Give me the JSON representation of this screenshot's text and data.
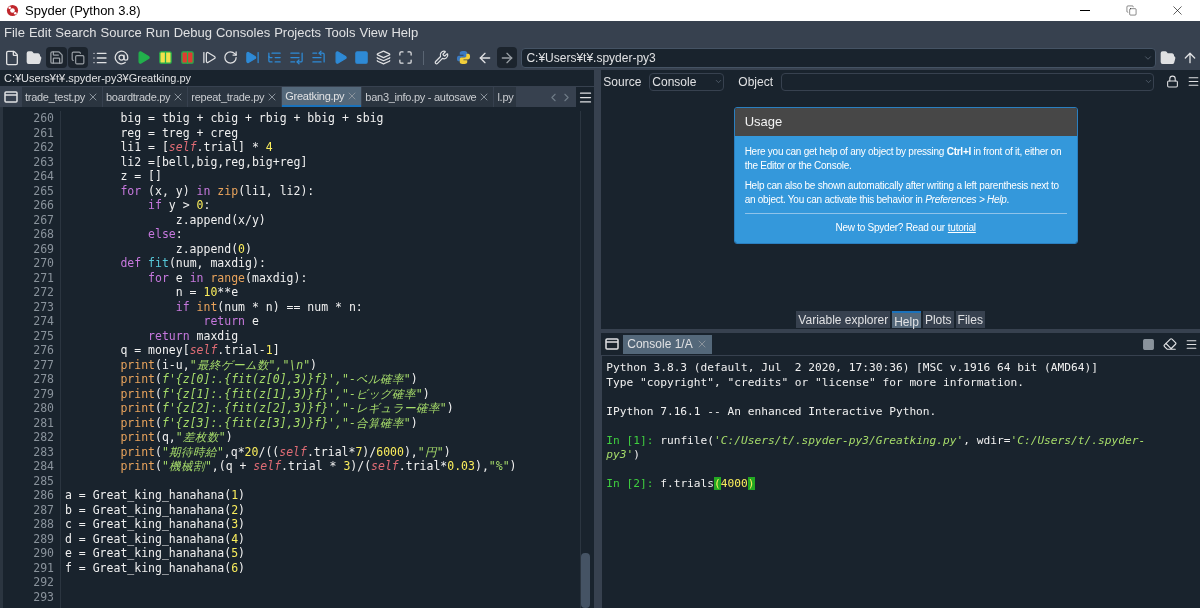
{
  "window": {
    "title": "Spyder (Python 3.8)"
  },
  "menu": [
    "File",
    "Edit",
    "Search",
    "Source",
    "Run",
    "Debug",
    "Consoles",
    "Projects",
    "Tools",
    "View",
    "Help"
  ],
  "working_directory": "C:¥Users¥t¥.spyder-py3",
  "editor": {
    "path": "C:¥Users¥t¥.spyder-py3¥Greatking.py",
    "tabs": [
      {
        "label": "trade_test.py",
        "selected": false,
        "closable": true
      },
      {
        "label": "boardtrade.py",
        "selected": false,
        "closable": true
      },
      {
        "label": "repeat_trade.py",
        "selected": false,
        "closable": true
      },
      {
        "label": "Greatking.py",
        "selected": true,
        "closable": true
      },
      {
        "label": "ban3_info.py - autosave",
        "selected": false,
        "closable": true
      },
      {
        "label": "l.py",
        "selected": false,
        "closable": false
      }
    ],
    "lines": [
      {
        "number": "260",
        "tokens": [
          {
            "kind": "plain",
            "text": "        big = tbig + cbig + rbig + bbig + sbig"
          }
        ]
      },
      {
        "number": "261",
        "tokens": [
          {
            "kind": "plain",
            "text": "        reg = treg + creg"
          }
        ]
      },
      {
        "number": "262",
        "tokens": [
          {
            "kind": "plain",
            "text": "        li1 = ["
          },
          {
            "kind": "self",
            "text": "self"
          },
          {
            "kind": "plain",
            "text": ".trial] * "
          },
          {
            "kind": "number",
            "text": "4"
          }
        ]
      },
      {
        "number": "263",
        "tokens": [
          {
            "kind": "plain",
            "text": "        li2 =[bell,big,reg,big+reg]"
          }
        ]
      },
      {
        "number": "264",
        "tokens": [
          {
            "kind": "plain",
            "text": "        z = []"
          }
        ]
      },
      {
        "number": "265",
        "tokens": [
          {
            "kind": "keyword",
            "text": "        for"
          },
          {
            "kind": "plain",
            "text": " (x, y) "
          },
          {
            "kind": "keyword",
            "text": "in"
          },
          {
            "kind": "builtin",
            "text": " zip"
          },
          {
            "kind": "plain",
            "text": "(li1, li2):"
          }
        ]
      },
      {
        "number": "266",
        "tokens": [
          {
            "kind": "keyword",
            "text": "            if"
          },
          {
            "kind": "plain",
            "text": " y > "
          },
          {
            "kind": "number",
            "text": "0"
          },
          {
            "kind": "plain",
            "text": ":"
          }
        ]
      },
      {
        "number": "267",
        "tokens": [
          {
            "kind": "plain",
            "text": "                z.append(x/y)"
          }
        ]
      },
      {
        "number": "268",
        "tokens": [
          {
            "kind": "keyword",
            "text": "            else"
          },
          {
            "kind": "plain",
            "text": ":"
          }
        ]
      },
      {
        "number": "269",
        "tokens": [
          {
            "kind": "plain",
            "text": "                z.append("
          },
          {
            "kind": "number",
            "text": "0"
          },
          {
            "kind": "plain",
            "text": ")"
          }
        ]
      },
      {
        "number": "270",
        "tokens": [
          {
            "kind": "keyword",
            "text": "        def"
          },
          {
            "kind": "function",
            "text": " fit"
          },
          {
            "kind": "plain",
            "text": "(num, maxdig):"
          }
        ]
      },
      {
        "number": "271",
        "tokens": [
          {
            "kind": "keyword",
            "text": "            for"
          },
          {
            "kind": "plain",
            "text": " e "
          },
          {
            "kind": "keyword",
            "text": "in"
          },
          {
            "kind": "builtin",
            "text": " range"
          },
          {
            "kind": "plain",
            "text": "(maxdig):"
          }
        ]
      },
      {
        "number": "272",
        "tokens": [
          {
            "kind": "plain",
            "text": "                n = "
          },
          {
            "kind": "number",
            "text": "10"
          },
          {
            "kind": "plain",
            "text": "**e"
          }
        ]
      },
      {
        "number": "273",
        "tokens": [
          {
            "kind": "keyword",
            "text": "                if"
          },
          {
            "kind": "builtin",
            "text": " int"
          },
          {
            "kind": "plain",
            "text": "(num * n) == num * n:"
          }
        ]
      },
      {
        "number": "274",
        "tokens": [
          {
            "kind": "keyword",
            "text": "                    return"
          },
          {
            "kind": "plain",
            "text": " e"
          }
        ]
      },
      {
        "number": "275",
        "tokens": [
          {
            "kind": "keyword",
            "text": "            return"
          },
          {
            "kind": "plain",
            "text": " maxdig"
          }
        ]
      },
      {
        "number": "276",
        "tokens": [
          {
            "kind": "plain",
            "text": "        q = money["
          },
          {
            "kind": "self",
            "text": "self"
          },
          {
            "kind": "plain",
            "text": ".trial-"
          },
          {
            "kind": "number",
            "text": "1"
          },
          {
            "kind": "plain",
            "text": "]"
          }
        ]
      },
      {
        "number": "277",
        "tokens": [
          {
            "kind": "builtin",
            "text": "        print"
          },
          {
            "kind": "plain",
            "text": "(i-u,"
          },
          {
            "kind": "string",
            "text": "\"最終ゲーム数\",\"\\n\""
          },
          {
            "kind": "plain",
            "text": ")"
          }
        ]
      },
      {
        "number": "278",
        "tokens": [
          {
            "kind": "builtin",
            "text": "        print"
          },
          {
            "kind": "plain",
            "text": "("
          },
          {
            "kind": "string",
            "text": "f'{z[0]:.{fit(z[0],3)}f}',\"-ベル確率\""
          },
          {
            "kind": "plain",
            "text": ")"
          }
        ]
      },
      {
        "number": "279",
        "tokens": [
          {
            "kind": "builtin",
            "text": "        print"
          },
          {
            "kind": "plain",
            "text": "("
          },
          {
            "kind": "string",
            "text": "f'{z[1]:.{fit(z[1],3)}f}',\"-ビッグ確率\""
          },
          {
            "kind": "plain",
            "text": ")"
          }
        ]
      },
      {
        "number": "280",
        "tokens": [
          {
            "kind": "builtin",
            "text": "        print"
          },
          {
            "kind": "plain",
            "text": "("
          },
          {
            "kind": "string",
            "text": "f'{z[2]:.{fit(z[2],3)}f}',\"-レギュラー確率\""
          },
          {
            "kind": "plain",
            "text": ")"
          }
        ]
      },
      {
        "number": "281",
        "tokens": [
          {
            "kind": "builtin",
            "text": "        print"
          },
          {
            "kind": "plain",
            "text": "("
          },
          {
            "kind": "string",
            "text": "f'{z[3]:.{fit(z[3],3)}f}',\"-合算確率\""
          },
          {
            "kind": "plain",
            "text": ")"
          }
        ]
      },
      {
        "number": "282",
        "tokens": [
          {
            "kind": "builtin",
            "text": "        print"
          },
          {
            "kind": "plain",
            "text": "(q,"
          },
          {
            "kind": "string",
            "text": "\"差枚数\""
          },
          {
            "kind": "plain",
            "text": ")"
          }
        ]
      },
      {
        "number": "283",
        "tokens": [
          {
            "kind": "builtin",
            "text": "        print"
          },
          {
            "kind": "plain",
            "text": "("
          },
          {
            "kind": "string",
            "text": "\"期待時給\""
          },
          {
            "kind": "plain",
            "text": ",q*"
          },
          {
            "kind": "number",
            "text": "20"
          },
          {
            "kind": "plain",
            "text": "/(("
          },
          {
            "kind": "self",
            "text": "self"
          },
          {
            "kind": "plain",
            "text": ".trial*"
          },
          {
            "kind": "number",
            "text": "7"
          },
          {
            "kind": "plain",
            "text": ")/"
          },
          {
            "kind": "number",
            "text": "6000"
          },
          {
            "kind": "plain",
            "text": "),"
          },
          {
            "kind": "string",
            "text": "\"円\""
          },
          {
            "kind": "plain",
            "text": ")"
          }
        ]
      },
      {
        "number": "284",
        "tokens": [
          {
            "kind": "builtin",
            "text": "        print"
          },
          {
            "kind": "plain",
            "text": "("
          },
          {
            "kind": "string",
            "text": "\"機械割\""
          },
          {
            "kind": "plain",
            "text": ",(q + "
          },
          {
            "kind": "self",
            "text": "self"
          },
          {
            "kind": "plain",
            "text": ".trial * "
          },
          {
            "kind": "number",
            "text": "3"
          },
          {
            "kind": "plain",
            "text": ")/("
          },
          {
            "kind": "self",
            "text": "self"
          },
          {
            "kind": "plain",
            "text": ".trial*"
          },
          {
            "kind": "number",
            "text": "0.03"
          },
          {
            "kind": "plain",
            "text": "),"
          },
          {
            "kind": "string",
            "text": "\"%\""
          },
          {
            "kind": "plain",
            "text": ")"
          }
        ]
      },
      {
        "number": "285"
      },
      {
        "number": "286",
        "tokens": [
          {
            "kind": "plain",
            "text": "a = Great_king_hanahana("
          },
          {
            "kind": "number",
            "text": "1"
          },
          {
            "kind": "plain",
            "text": ")"
          }
        ]
      },
      {
        "number": "287",
        "tokens": [
          {
            "kind": "plain",
            "text": "b = Great_king_hanahana("
          },
          {
            "kind": "number",
            "text": "2"
          },
          {
            "kind": "plain",
            "text": ")"
          }
        ]
      },
      {
        "number": "288",
        "tokens": [
          {
            "kind": "plain",
            "text": "c = Great_king_hanahana("
          },
          {
            "kind": "number",
            "text": "3"
          },
          {
            "kind": "plain",
            "text": ")"
          }
        ]
      },
      {
        "number": "289",
        "tokens": [
          {
            "kind": "plain",
            "text": "d = Great_king_hanahana("
          },
          {
            "kind": "number",
            "text": "4"
          },
          {
            "kind": "plain",
            "text": ")"
          }
        ]
      },
      {
        "number": "290",
        "tokens": [
          {
            "kind": "plain",
            "text": "e = Great_king_hanahana("
          },
          {
            "kind": "number",
            "text": "5"
          },
          {
            "kind": "plain",
            "text": ")"
          }
        ]
      },
      {
        "number": "291",
        "tokens": [
          {
            "kind": "plain",
            "text": "f = Great_king_hanahana("
          },
          {
            "kind": "number",
            "text": "6"
          },
          {
            "kind": "plain",
            "text": ")"
          }
        ]
      },
      {
        "number": "292"
      },
      {
        "number": "293"
      }
    ]
  },
  "help": {
    "source_label": "Source",
    "source_value": "Console",
    "object_label": "Object",
    "usage": {
      "title": "Usage",
      "paragraphs": [
        "Here you can get help of any object by pressing **Ctrl+I** in front of it, either on the Editor or the Console.",
        "Help can also be shown automatically after writing a left parenthesis next to an object. You can activate this behavior in *Preferences > Help*."
      ],
      "footer": "New to Spyder? Read our",
      "link": "tutorial"
    }
  },
  "pane_tabs": [
    {
      "label": "Variable explorer",
      "selected": false
    },
    {
      "label": "Help",
      "selected": true
    },
    {
      "label": "Plots",
      "selected": false
    },
    {
      "label": "Files",
      "selected": false
    }
  ],
  "console": {
    "tabs": [
      {
        "label": "Console 1/A",
        "selected": true
      }
    ],
    "blocks": [
      [
        [
          {
            "kind": "plain",
            "text": "Python 3.8.3 (default, Jul  2 2020, 17:30:36) [MSC v.1916 64 bit (AMD64)]"
          }
        ],
        [
          {
            "kind": "plain",
            "text": "Type \"copyright\", \"credits\" or \"license\" for more information."
          }
        ]
      ],
      [
        [
          {
            "kind": "plain",
            "text": "IPython 7.16.1 -- An enhanced Interactive Python."
          }
        ]
      ],
      [
        [
          {
            "kind": "prompt",
            "text": "In [1]:"
          },
          {
            "kind": "plain",
            "text": " runfile("
          },
          {
            "kind": "string",
            "text": "'C:/Users/t/.spyder-py3/Greatking.py'"
          },
          {
            "kind": "plain",
            "text": ", wdir="
          },
          {
            "kind": "string",
            "text": "'C:/Users/t/.spyder-"
          }
        ],
        [
          {
            "kind": "string",
            "text": "py3'"
          },
          {
            "kind": "plain",
            "text": ")"
          }
        ]
      ],
      [
        [
          {
            "kind": "prompt",
            "text": "In [2]:"
          },
          {
            "kind": "plain",
            "text": " f.trials"
          },
          {
            "kind": "match",
            "text": "("
          },
          {
            "kind": "number",
            "text": "4000"
          },
          {
            "kind": "match",
            "text": ")"
          }
        ]
      ]
    ]
  }
}
